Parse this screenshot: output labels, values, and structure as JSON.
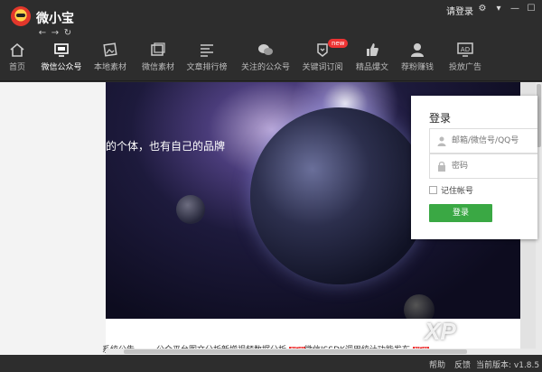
{
  "app": {
    "title": "微小宝",
    "login_link": "请登录"
  },
  "toolbar": {
    "items": [
      {
        "label": "首页",
        "icon": "home-icon"
      },
      {
        "label": "微信公众号",
        "icon": "monitor-icon",
        "active": true
      },
      {
        "label": "本地素材",
        "icon": "image-folder-icon"
      },
      {
        "label": "微信素材",
        "icon": "images-icon"
      },
      {
        "label": "文章排行榜",
        "icon": "list-icon"
      },
      {
        "label": "关注的公众号",
        "icon": "chat-icon"
      },
      {
        "label": "关键词订阅",
        "icon": "bell-badge-icon",
        "badge": "new"
      },
      {
        "label": "精品爆文",
        "icon": "thumbs-up-icon"
      },
      {
        "label": "荐粉赚钱",
        "icon": "person-icon"
      },
      {
        "label": "投放广告",
        "icon": "ad-icon",
        "icon_text": "AD"
      }
    ]
  },
  "banner": {
    "slogan": "的个体，也有自己的品牌"
  },
  "login": {
    "title": "登录",
    "account_placeholder": "邮箱/微信号/QQ号",
    "password_placeholder": "密码",
    "remember_label": "记住帐号",
    "button_label": "登录"
  },
  "news": [
    {
      "text": "系统公告",
      "new": false
    },
    {
      "text": "公众平台图文分析新增视频数据分析",
      "new": true
    },
    {
      "text": "微信JSSDK调用统计功能发布",
      "new": true
    }
  ],
  "status": {
    "help": "帮助",
    "feedback": "反馈",
    "version": "当前版本: v1.8.5"
  },
  "watermark": {
    "text": "XP"
  },
  "colors": {
    "accent_green": "#3aa844",
    "badge_red": "#e33333",
    "chrome": "#2d2d2d"
  }
}
